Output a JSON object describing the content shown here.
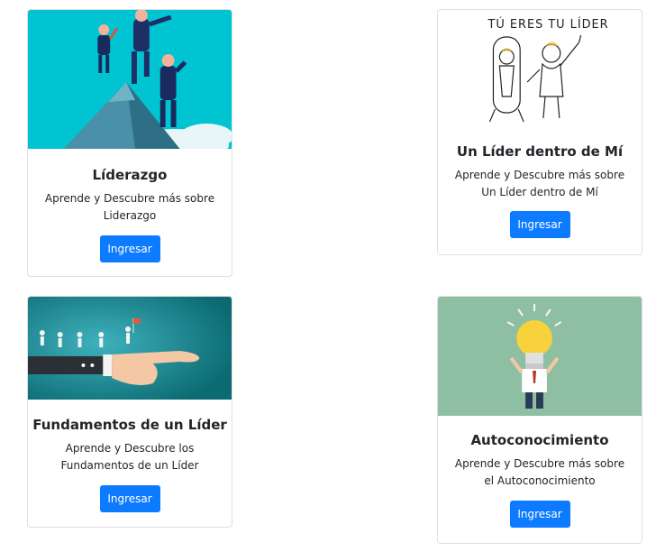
{
  "cards": [
    {
      "image": "business-team-mountain-illustration",
      "title": "Líderazgo",
      "text": "Aprende y Descubre más sobre Liderazgo",
      "button": "Ingresar"
    },
    {
      "image": "tu-eres-tu-lider-sketch",
      "image_caption": "TÚ ERES TU LÍDER",
      "title": "Un Líder dentro de Mí",
      "text": "Aprende y Descubre más sobre Un Líder dentro de Mí",
      "button": "Ingresar"
    },
    {
      "image": "hand-pointing-runners-illustration",
      "title": "Fundamentos de un Líder",
      "text": "Aprende y Descubre los Fundamentos de un Líder",
      "button": "Ingresar"
    },
    {
      "image": "lightbulb-head-person-illustration",
      "title": "Autoconocimiento",
      "text": "Aprende y Descubre más sobre el Autoconocimiento",
      "button": "Ingresar"
    }
  ],
  "colors": {
    "button": "#0d7bff",
    "card_border": "rgba(0,0,0,0.125)",
    "teal": "#00c4d1",
    "sage": "#8fbfa2"
  }
}
